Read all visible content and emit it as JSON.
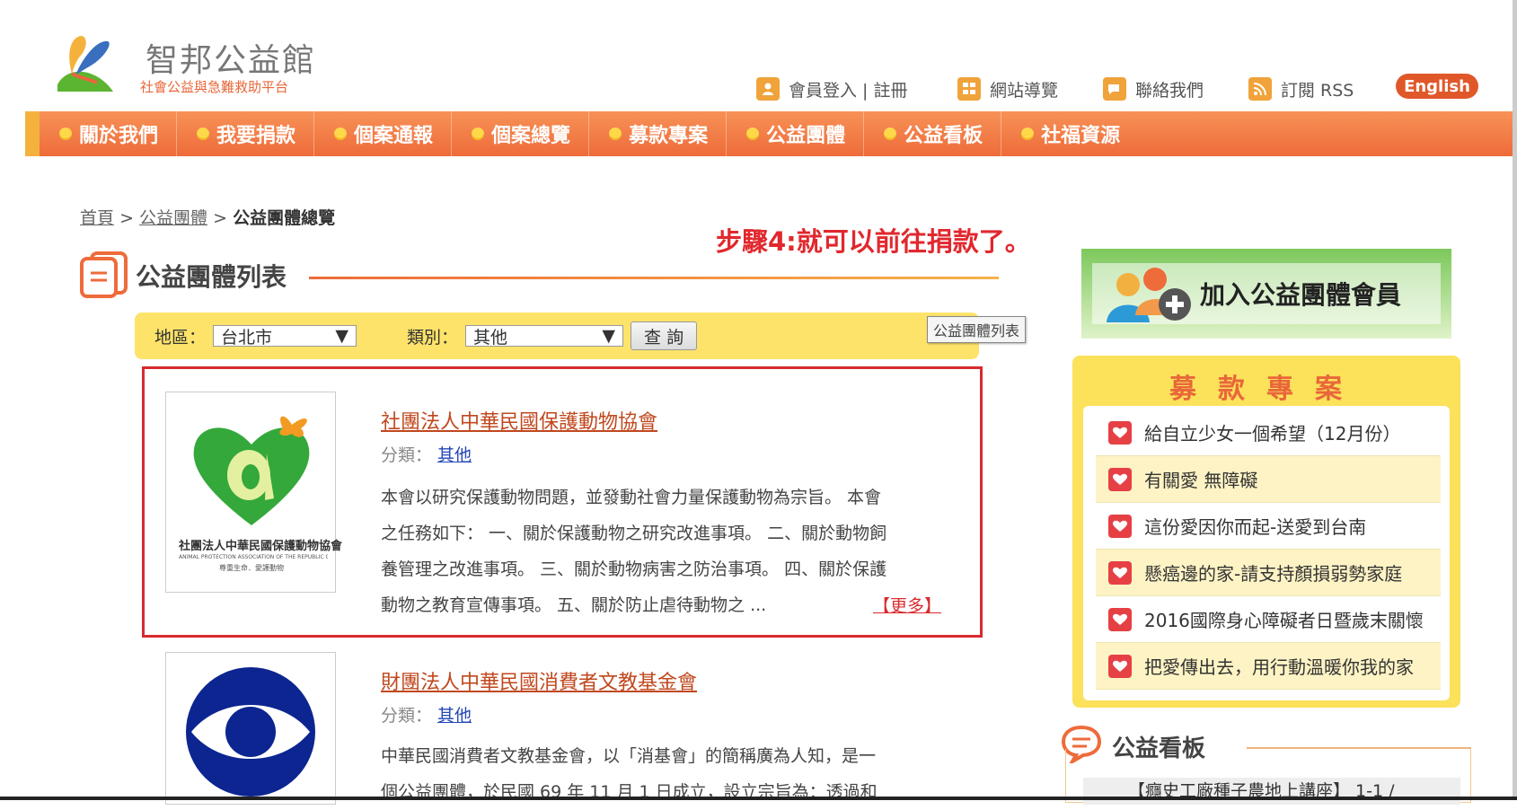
{
  "header": {
    "logo_title": "智邦公益館",
    "logo_subtitle": "社會公益與急難救助平台",
    "toplinks": {
      "login": "會員登入 | 註冊",
      "sitemap": "網站導覽",
      "contact": "聯絡我們",
      "rss": "訂閱 RSS",
      "english": "English"
    }
  },
  "nav": {
    "items": [
      "關於我們",
      "我要捐款",
      "個案通報",
      "個案總覽",
      "募款專案",
      "公益團體",
      "公益看板",
      "社福資源"
    ]
  },
  "breadcrumb": {
    "home": "首頁",
    "sep1": ">",
    "section": "公益團體",
    "sep2": ">",
    "current": "公益團體總覽"
  },
  "annotation": "步驟4:就可以前往捐款了。",
  "main": {
    "section_title": "公益團體列表",
    "filter": {
      "region_label": "地區：",
      "region_value": "台北市",
      "category_label": "類別：",
      "category_value": "其他",
      "query_button": "查 詢"
    },
    "tooltip": "公益團體列表",
    "orgs": [
      {
        "name": "社團法人中華民國保護動物協會",
        "cat_label": "分類：",
        "cat_value": "其他",
        "desc_lines": [
          "本會以研究保護動物問題，並發動社會力量保護動物為宗旨。 本會",
          "之任務如下： 一、關於保護動物之研究改進事項。 二、關於動物飼",
          "養管理之改進事項。 三、關於動物病害之防治事項。 四、關於保護",
          "動物之教育宣傳事項。 五、關於防止虐待動物之 ..."
        ],
        "more": "【更多】",
        "logo_caption": "社團法人中華民國保護動物協會",
        "logo_en": "ANIMAL PROTECTION ASSOCIATION OF THE REPUBLIC OF CHINA",
        "logo_motto": "尊重生命．愛護動物"
      },
      {
        "name": "財團法人中華民國消費者文教基金會",
        "cat_label": "分類：",
        "cat_value": "其他",
        "desc_lines": [
          "中華民國消費者文教基金會，以「消基會」的簡稱廣為人知，是一",
          "個公益團體，於民國 69 年 11 月 1 日成立，設立宗旨為：透過和"
        ]
      }
    ]
  },
  "sidebar": {
    "join_label": "加入公益團體會員",
    "fund_title": "募款專案",
    "fund_items": [
      "給自立少女一個希望（12月份）",
      "有關愛 無障礙",
      "這份愛因你而起-送愛到台南",
      "懸癌邊的家-請支持顏損弱勢家庭",
      "2016國際身心障礙者日暨歲末關懷",
      "把愛傳出去，用行動溫暖你我的家"
    ],
    "board_title": "公益看板",
    "board_item": "【癮史工廠種子農地上講座】 1-1 /"
  },
  "colors": {
    "nav_orange": "#ee6b3a",
    "accent_yellow": "#fde36a",
    "highlight_red": "#d92a2e",
    "link_brown": "#c0481e"
  }
}
